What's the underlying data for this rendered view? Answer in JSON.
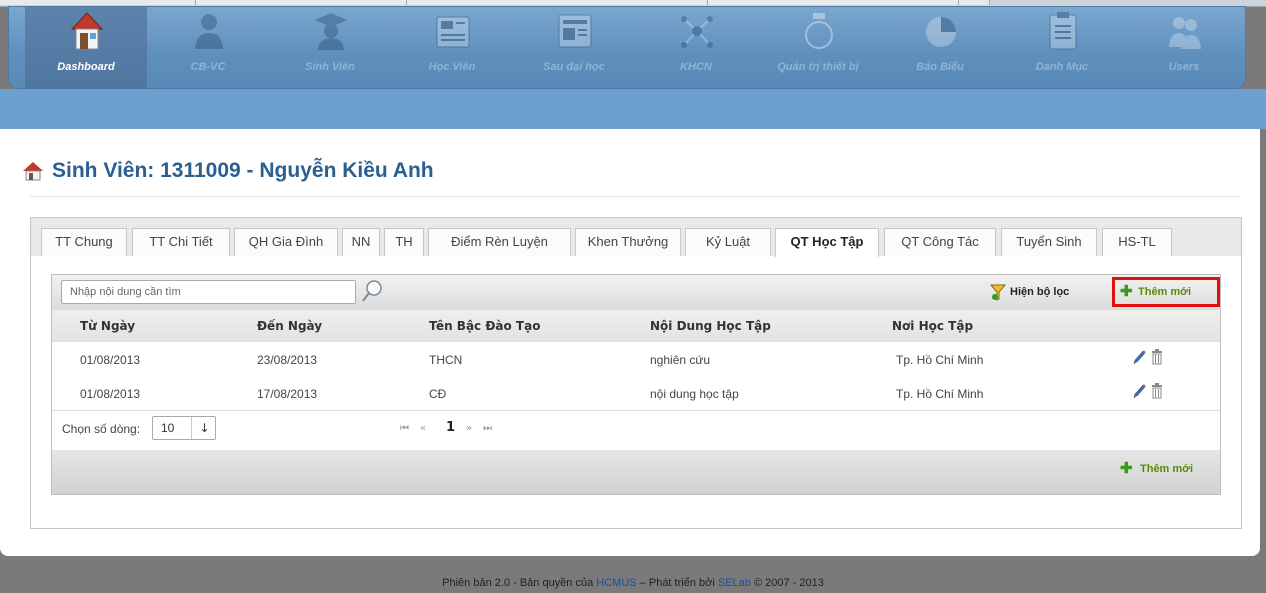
{
  "nav": {
    "items": [
      {
        "label": "Dashboard",
        "icon": "house-icon",
        "active": true
      },
      {
        "label": "CB-VC",
        "icon": "staff-icon",
        "active": false
      },
      {
        "label": "Sinh Viên",
        "icon": "graduate-icon",
        "active": false
      },
      {
        "label": "Học Viên",
        "icon": "newspaper-icon",
        "active": false
      },
      {
        "label": "Sau đại học",
        "icon": "news-icon",
        "active": false
      },
      {
        "label": "KHCN",
        "icon": "molecule-icon",
        "active": false
      },
      {
        "label": "Quản trị thiết bị",
        "icon": "device-icon",
        "active": false
      },
      {
        "label": "Báo Biểu",
        "icon": "pie-chart-icon",
        "active": false
      },
      {
        "label": "Danh Mục",
        "icon": "clipboard-icon",
        "active": false
      },
      {
        "label": "Users",
        "icon": "users-icon",
        "active": false
      }
    ]
  },
  "page": {
    "title": "Sinh Viên: 1311009 - Nguyễn Kiều Anh"
  },
  "tabs": [
    {
      "label": "TT Chung",
      "active": false
    },
    {
      "label": "TT Chi Tiết",
      "active": false
    },
    {
      "label": "QH Gia Đình",
      "active": false
    },
    {
      "label": "NN",
      "active": false
    },
    {
      "label": "TH",
      "active": false
    },
    {
      "label": "Điểm Rèn Luyện",
      "active": false
    },
    {
      "label": "Khen Thưởng",
      "active": false
    },
    {
      "label": "Kỷ Luật",
      "active": false
    },
    {
      "label": "QT Học Tập",
      "active": true
    },
    {
      "label": "QT Công Tác",
      "active": false
    },
    {
      "label": "Tuyển Sinh",
      "active": false
    },
    {
      "label": "HS-TL",
      "active": false
    }
  ],
  "toolbar": {
    "search_placeholder": "Nhập nội dung cần tìm",
    "filter_label": "Hiện bộ lọc",
    "add_label": "Thêm mới"
  },
  "table": {
    "columns": [
      "Từ Ngày",
      "Đến Ngày",
      "Tên Bậc Đào Tạo",
      "Nội Dung Học Tập",
      "Nơi Học Tập"
    ],
    "rows": [
      [
        "01/08/2013",
        "23/08/2013",
        "THCN",
        "nghiên cứu",
        "Tp. Hồ Chí Minh"
      ],
      [
        "01/08/2013",
        "17/08/2013",
        "CĐ",
        "nội dung học tập",
        "Tp. Hồ Chí Minh"
      ]
    ]
  },
  "pager": {
    "rows_label": "Chọn số dòng:",
    "rows_value": "10",
    "page": "1",
    "first": "⏮",
    "prev": "«",
    "next": "»",
    "last": "⏭"
  },
  "footer": {
    "add_label": "Thêm mới",
    "prefix": "Phiên bản 2.0 - Bản quyền của",
    "org": "HCMUS",
    "mid": "– Phát triển bởi",
    "dev": "SELab",
    "suffix": "© 2007 - 2013"
  },
  "colors": {
    "nav_gradient_top": "#7aa7cf",
    "nav_gradient_bottom": "#5a89b7",
    "title": "#2a5f8f",
    "highlight_box": "#e01010",
    "add_green": "#3c9a1c",
    "link": "#1a4fa0"
  }
}
